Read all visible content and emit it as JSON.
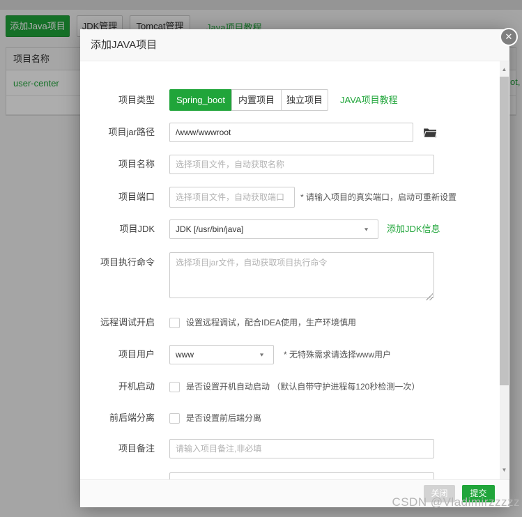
{
  "colors": {
    "accent_green": "#20a53a"
  },
  "background": {
    "toolbar": {
      "add_java_button": "添加Java项目",
      "jdk_manage_button": "JDK管理",
      "tomcat_manage_button": "Tomcat管理",
      "tutorial_link": "Java项目教程"
    },
    "table": {
      "name_header": "项目名称",
      "project_name": "user-center",
      "path_fragment": "ot,"
    }
  },
  "modal": {
    "title": "添加JAVA项目",
    "close_icon": "✕",
    "form": {
      "project_type": {
        "label": "项目类型",
        "options": [
          "Spring_boot",
          "内置项目",
          "独立项目"
        ],
        "selected": "Spring_boot",
        "tutorial_link": "JAVA项目教程"
      },
      "jar_path": {
        "label": "项目jar路径",
        "value": "/www/wwwroot"
      },
      "project_name": {
        "label": "项目名称",
        "placeholder": "选择项目文件，自动获取名称"
      },
      "project_port": {
        "label": "项目端口",
        "placeholder": "选择项目文件，自动获取端口",
        "note": "* 请输入项目的真实端口，启动可重新设置"
      },
      "project_jdk": {
        "label": "项目JDK",
        "value": "JDK [/usr/bin/java]",
        "add_jdk_link": "添加JDK信息"
      },
      "exec_command": {
        "label": "项目执行命令",
        "placeholder": "选择项目jar文件，自动获取项目执行命令"
      },
      "remote_debug": {
        "label": "远程调试开启",
        "text": "设置远程调试，配合IDEA使用，生产环境慎用",
        "checked": false
      },
      "project_user": {
        "label": "项目用户",
        "value": "www",
        "note": "* 无特殊需求请选择www用户"
      },
      "auto_start": {
        "label": "开机启动",
        "text": "是否设置开机自动启动 （默认自带守护进程每120秒检测一次）",
        "checked": false
      },
      "front_back_separation": {
        "label": "前后端分离",
        "text": "是否设置前后端分离",
        "checked": false
      },
      "project_note": {
        "label": "项目备注",
        "placeholder": "请输入项目备注,非必填"
      }
    },
    "footer": {
      "close_button": "关闭",
      "submit_button": "提交"
    },
    "scrollbar": {
      "up_icon": "▲",
      "down_icon": "▼"
    },
    "select_arrow_icon": "▼"
  },
  "watermark": "CSDN @Vladimirzzzzz"
}
